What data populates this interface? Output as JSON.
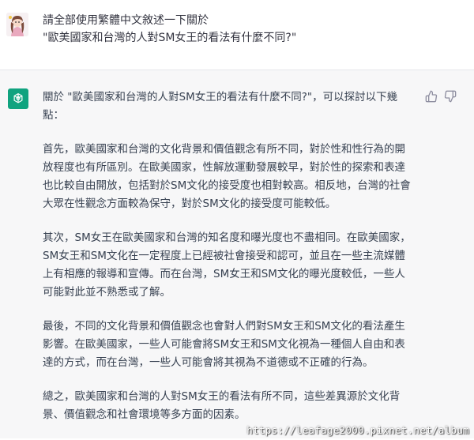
{
  "user_message": {
    "lines": [
      "請全部使用繁體中文敘述一下關於",
      "\"歐美國家和台灣的人對SM女王的看法有什麼不同?\""
    ]
  },
  "assistant_message": {
    "paragraphs": [
      [
        "關於 \"歐美國家和台灣的人對SM女王的看法有什麼不同?\"，可以探討以下幾",
        "點："
      ],
      [
        "首先，歐美國家和台灣的文化背景和價值觀念有所不同，對於性和性行為的開",
        "放程度也有所區別。在歐美國家，性解放運動發展較早，對於性的探索和表達",
        "也比較自由開放，包括對於SM文化的接受度也相對較高。相反地，台灣的社會",
        "大眾在性觀念方面較為保守，對於SM文化的接受度可能較低。"
      ],
      [
        "其次，SM女王在歐美國家和台灣的知名度和曝光度也不盡相同。在歐美國家，",
        "SM女王和SM文化在一定程度上已經被社會接受和認可，並且在一些主流媒體",
        "上有相應的報導和宣傳。而在台灣，SM女王和SM文化的曝光度較低，一些人",
        "可能對此並不熟悉或了解。"
      ],
      [
        "最後，不同的文化背景和價值觀念也會對人們對SM女王和SM文化的看法產生",
        "影響。在歐美國家，一些人可能會將SM女王和SM文化視為一種個人自由和表",
        "達的方式，而在台灣，一些人可能會將其視為不道德或不正確的行為。"
      ],
      [
        "總之，歐美國家和台灣的人對SM女王的看法有所不同，這些差異源於文化背",
        "景、價值觀念和社會環境等多方面的因素。"
      ]
    ]
  },
  "icons": {
    "assistant_logo": "openai-logo-icon",
    "thumbs_up": "thumbs-up-icon",
    "thumbs_down": "thumbs-down-icon",
    "avatar": "user-avatar"
  },
  "colors": {
    "assistant_bg": "#f7f7f8",
    "logo_bg": "#10a37f",
    "text": "#374151"
  },
  "watermark": "https://leafage2000.pixnet.net/album"
}
